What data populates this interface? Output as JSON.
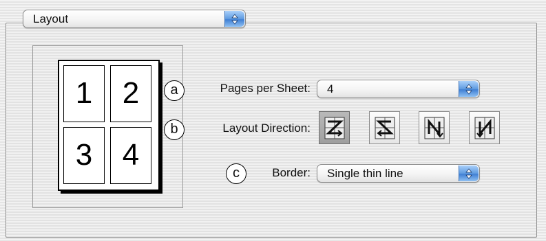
{
  "panel_menu": {
    "value": "Layout",
    "icon": "up-down-arrows-icon"
  },
  "preview": {
    "pages": [
      "1",
      "2",
      "3",
      "4"
    ]
  },
  "callouts": {
    "a": "a",
    "b": "b",
    "c": "c"
  },
  "pages_per_sheet": {
    "label": "Pages per Sheet:",
    "value": "4",
    "icon": "up-down-arrows-icon"
  },
  "layout_direction": {
    "label": "Layout Direction:",
    "options": [
      {
        "icon": "z-left-right-top-bottom-icon",
        "selected": true
      },
      {
        "icon": "s-right-left-top-bottom-icon",
        "selected": false
      },
      {
        "icon": "n-top-bottom-left-right-icon",
        "selected": false
      },
      {
        "icon": "n-top-bottom-right-left-icon",
        "selected": false
      }
    ]
  },
  "border": {
    "label": "Border:",
    "value": "Single thin line",
    "icon": "up-down-arrows-icon"
  },
  "colors": {
    "accent": "#4a8ad9",
    "background": "#ececec"
  }
}
